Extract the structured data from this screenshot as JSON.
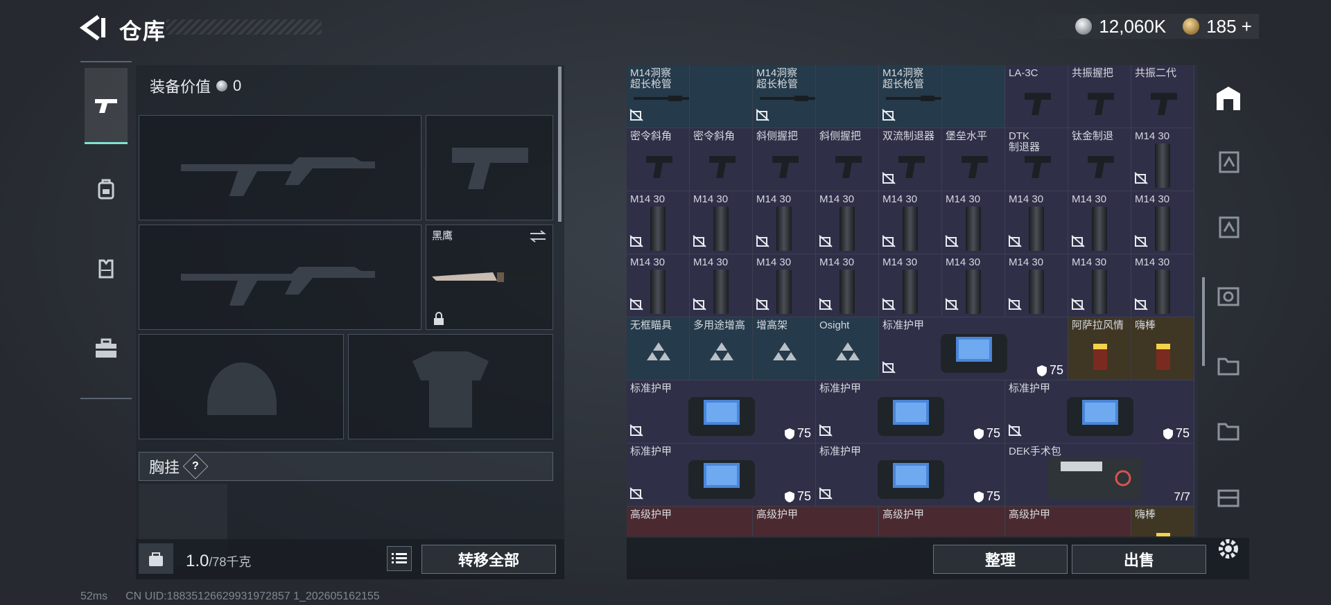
{
  "header": {
    "title": "仓库",
    "silver": "12,060K",
    "gold": "185 +"
  },
  "nav": [
    {
      "name": "weapons",
      "active": true
    },
    {
      "name": "backpack",
      "active": false
    },
    {
      "name": "armor",
      "active": false
    },
    {
      "name": "case",
      "active": false
    }
  ],
  "left": {
    "equip_label": "装备价值",
    "equip_value": "0",
    "knife_name": "黑鹰",
    "chest_label": "胸挂",
    "chest_help": "?",
    "weight_value": "1.0",
    "weight_max": "/78千克",
    "transfer_all": "转移全部"
  },
  "grid": {
    "rows": [
      [
        {
          "n": "M14洞察\n超长枪管",
          "c": "blue",
          "u": true
        },
        {
          "n": "",
          "c": "blue"
        },
        {
          "n": "M14洞察\n超长枪管",
          "c": "blue",
          "u": true
        },
        {
          "n": "",
          "c": "blue"
        },
        {
          "n": "M14洞察\n超长枪管",
          "c": "blue",
          "u": true
        },
        {
          "n": "",
          "c": "blue"
        },
        {
          "n": "LA-3C",
          "c": "purple"
        },
        {
          "n": "共振握把",
          "c": "purple"
        },
        {
          "n": "共振二代",
          "c": "purple"
        }
      ],
      [
        {
          "n": "密令斜角",
          "c": "purple"
        },
        {
          "n": "密令斜角",
          "c": "purple"
        },
        {
          "n": "斜侧握把",
          "c": "purple"
        },
        {
          "n": "斜侧握把",
          "c": "purple"
        },
        {
          "n": "双流制退器",
          "c": "purple",
          "u": true
        },
        {
          "n": "堡垒水平",
          "c": "purple"
        },
        {
          "n": "DTK\n制退器",
          "c": "purple"
        },
        {
          "n": "钛金制退",
          "c": "purple"
        },
        {
          "n": "M14 30",
          "c": "purple",
          "u": true
        }
      ],
      [
        {
          "n": "M14 30",
          "c": "purple",
          "u": true
        },
        {
          "n": "M14 30",
          "c": "purple",
          "u": true
        },
        {
          "n": "M14 30",
          "c": "purple",
          "u": true
        },
        {
          "n": "M14 30",
          "c": "purple",
          "u": true
        },
        {
          "n": "M14 30",
          "c": "purple",
          "u": true
        },
        {
          "n": "M14 30",
          "c": "purple",
          "u": true
        },
        {
          "n": "M14 30",
          "c": "purple",
          "u": true
        },
        {
          "n": "M14 30",
          "c": "purple",
          "u": true
        },
        {
          "n": "M14 30",
          "c": "purple",
          "u": true
        }
      ],
      [
        {
          "n": "M14 30",
          "c": "purple",
          "u": true
        },
        {
          "n": "M14 30",
          "c": "purple",
          "u": true
        },
        {
          "n": "M14 30",
          "c": "purple",
          "u": true
        },
        {
          "n": "M14 30",
          "c": "purple",
          "u": true
        },
        {
          "n": "M14 30",
          "c": "purple",
          "u": true
        },
        {
          "n": "M14 30",
          "c": "purple",
          "u": true
        },
        {
          "n": "M14 30",
          "c": "purple",
          "u": true
        },
        {
          "n": "M14 30",
          "c": "purple",
          "u": true
        },
        {
          "n": "M14 30",
          "c": "purple",
          "u": true
        }
      ],
      [
        {
          "n": "无框瞄具",
          "c": "blue"
        },
        {
          "n": "多用途增高",
          "c": "blue"
        },
        {
          "n": "增高架",
          "c": "blue"
        },
        {
          "n": "Osight",
          "c": "blue"
        },
        {
          "n": "标准护甲",
          "c": "purple",
          "wide": 3,
          "u": true,
          "shield": "75"
        },
        {
          "n": "",
          "c": "purple",
          "skip": true
        },
        {
          "n": "",
          "c": "purple",
          "skip": true
        },
        {
          "n": "阿萨拉风情",
          "c": "gold"
        },
        {
          "n": "嗨棒",
          "c": "gold"
        }
      ],
      [
        {
          "n": "标准护甲",
          "c": "purple",
          "wide": 3,
          "u": true,
          "shield": "75"
        },
        {
          "n": "",
          "skip": true
        },
        {
          "n": "",
          "skip": true
        },
        {
          "n": "标准护甲",
          "c": "purple",
          "wide": 3,
          "u": true,
          "shield": "75"
        },
        {
          "n": "",
          "skip": true
        },
        {
          "n": "",
          "skip": true
        },
        {
          "n": "标准护甲",
          "c": "purple",
          "wide": 3,
          "u": true,
          "shield": "75"
        },
        {
          "n": "",
          "skip": true
        },
        {
          "n": "",
          "skip": true
        }
      ],
      [
        {
          "n": "标准护甲",
          "c": "purple",
          "wide": 3,
          "u": true,
          "shield": "75"
        },
        {
          "n": "",
          "skip": true
        },
        {
          "n": "",
          "skip": true
        },
        {
          "n": "标准护甲",
          "c": "purple",
          "wide": 3,
          "u": true,
          "shield": "75"
        },
        {
          "n": "",
          "skip": true
        },
        {
          "n": "",
          "skip": true
        },
        {
          "n": "DEK手术包",
          "c": "purple",
          "wide": 3,
          "count": "7/7"
        },
        {
          "n": "",
          "skip": true
        },
        {
          "n": "",
          "skip": true
        }
      ],
      [
        {
          "n": "高级护甲",
          "c": "red",
          "wide": 2
        },
        {
          "n": "",
          "skip": true
        },
        {
          "n": "高级护甲",
          "c": "red",
          "wide": 2
        },
        {
          "n": "",
          "skip": true
        },
        {
          "n": "高级护甲",
          "c": "red",
          "wide": 2
        },
        {
          "n": "",
          "skip": true
        },
        {
          "n": "高级护甲",
          "c": "red",
          "wide": 2
        },
        {
          "n": "",
          "skip": true
        },
        {
          "n": "嗨棒",
          "c": "gold"
        }
      ]
    ]
  },
  "actions": {
    "sort": "整理",
    "sell": "出售"
  },
  "footer": {
    "ping": "52ms",
    "uid": "CN UID:18835126629931972857 1_202605162155"
  }
}
